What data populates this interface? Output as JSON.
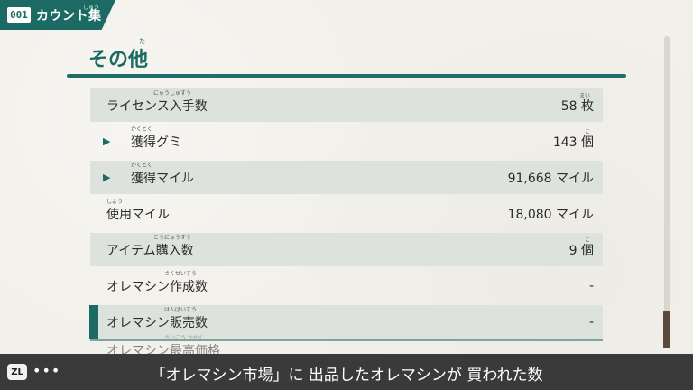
{
  "header": {
    "counter_icon": "001",
    "title": "カウント集",
    "title_ruby": "しゅう"
  },
  "section": {
    "title": "その他",
    "ruby": "た"
  },
  "rows": [
    {
      "label": "ライセンス入手数",
      "ruby": "にゅうしゅすう",
      "value": "58 枚",
      "value_ruby": "まい",
      "shaded": true
    },
    {
      "label": "獲得グミ",
      "ruby": "かくとく",
      "value": "143 個",
      "value_ruby": "こ",
      "shaded": false,
      "expand": true
    },
    {
      "label": "獲得マイル",
      "ruby": "かくとく",
      "value": "91,668 マイル",
      "value_ruby": "",
      "shaded": true,
      "expand": true
    },
    {
      "label": "使用マイル",
      "ruby": "しよう",
      "value": "18,080 マイル",
      "value_ruby": "",
      "shaded": false
    },
    {
      "label": "アイテム購入数",
      "ruby": "こうにゅうすう",
      "value": "9 個",
      "value_ruby": "こ",
      "shaded": true
    },
    {
      "label": "オレマシン作成数",
      "ruby": "さくせいすう",
      "value": "-",
      "value_ruby": "",
      "shaded": false
    },
    {
      "label": "オレマシン販売数",
      "ruby": "はんばいすう",
      "value": "-",
      "value_ruby": "",
      "selected": true
    },
    {
      "label": "オレマシン最高価格",
      "ruby": "さいこう かかく",
      "value": "",
      "value_ruby": "",
      "partial": true
    }
  ],
  "hint": {
    "button": "ZL",
    "dots": "•••",
    "text": "「オレマシン市場」に 出品したオレマシンが 買われた数"
  },
  "colors": {
    "accent": "#1b6a64",
    "row_shade": "#dde3dc",
    "background": "#f2f0ea",
    "hint_bar": "#3a3a3a"
  }
}
